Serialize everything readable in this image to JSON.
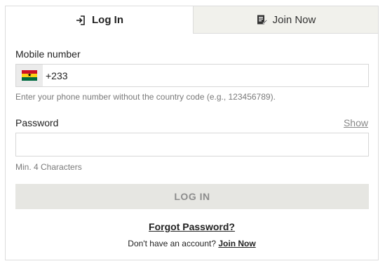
{
  "tabs": {
    "login": {
      "label": "Log In",
      "icon": "login-icon"
    },
    "join": {
      "label": "Join Now",
      "icon": "register-icon"
    }
  },
  "form": {
    "mobile_label": "Mobile number",
    "country_flag": "ghana-flag-icon",
    "country_code": "+233",
    "mobile_hint": "Enter your phone number without the country code (e.g., 123456789).",
    "password_label": "Password",
    "show_label": "Show",
    "password_value": "",
    "password_hint": "Min. 4 Characters",
    "submit_label": "LOG IN"
  },
  "footer": {
    "forgot_label": "Forgot Password?",
    "no_account_text": "Don't have an account?",
    "join_link_label": "Join Now"
  },
  "colors": {
    "inactive_tab_bg": "#f1f1ec",
    "button_bg": "#e6e6e2",
    "button_text": "#8d8d8d",
    "border": "#d7d7d7"
  }
}
